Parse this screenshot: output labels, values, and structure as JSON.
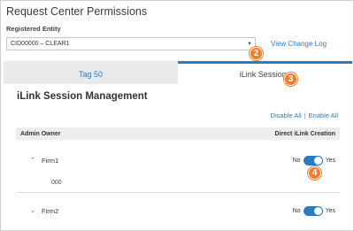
{
  "header": {
    "title": "Request Center Permissions",
    "entity_label": "Registered Entity"
  },
  "entity_select": {
    "value": "CID00000 – CLEAR1"
  },
  "view_change_log": "View Change Log",
  "callouts": {
    "c2": "2",
    "c3": "3",
    "c4": "4"
  },
  "tabs": [
    {
      "label": "Tag 50",
      "active": false
    },
    {
      "label": "iLink Sessions",
      "active": true
    }
  ],
  "section": {
    "title": "iLink Session Management",
    "disable_all": "Disable All",
    "separator": "|",
    "enable_all": "Enable All"
  },
  "table": {
    "col_admin_owner": "Admin Owner",
    "col_direct_ilink": "Direct iLink Creation",
    "rows": [
      {
        "name": "Firm1",
        "expanded": true,
        "sub_value": "000",
        "no_label": "No",
        "yes_label": "Yes",
        "enabled": true
      },
      {
        "name": "Firm2",
        "expanded": false,
        "no_label": "No",
        "yes_label": "Yes",
        "enabled": true
      }
    ]
  },
  "colors": {
    "accent": "#2a7bbf",
    "callout": "#ed7d31"
  }
}
